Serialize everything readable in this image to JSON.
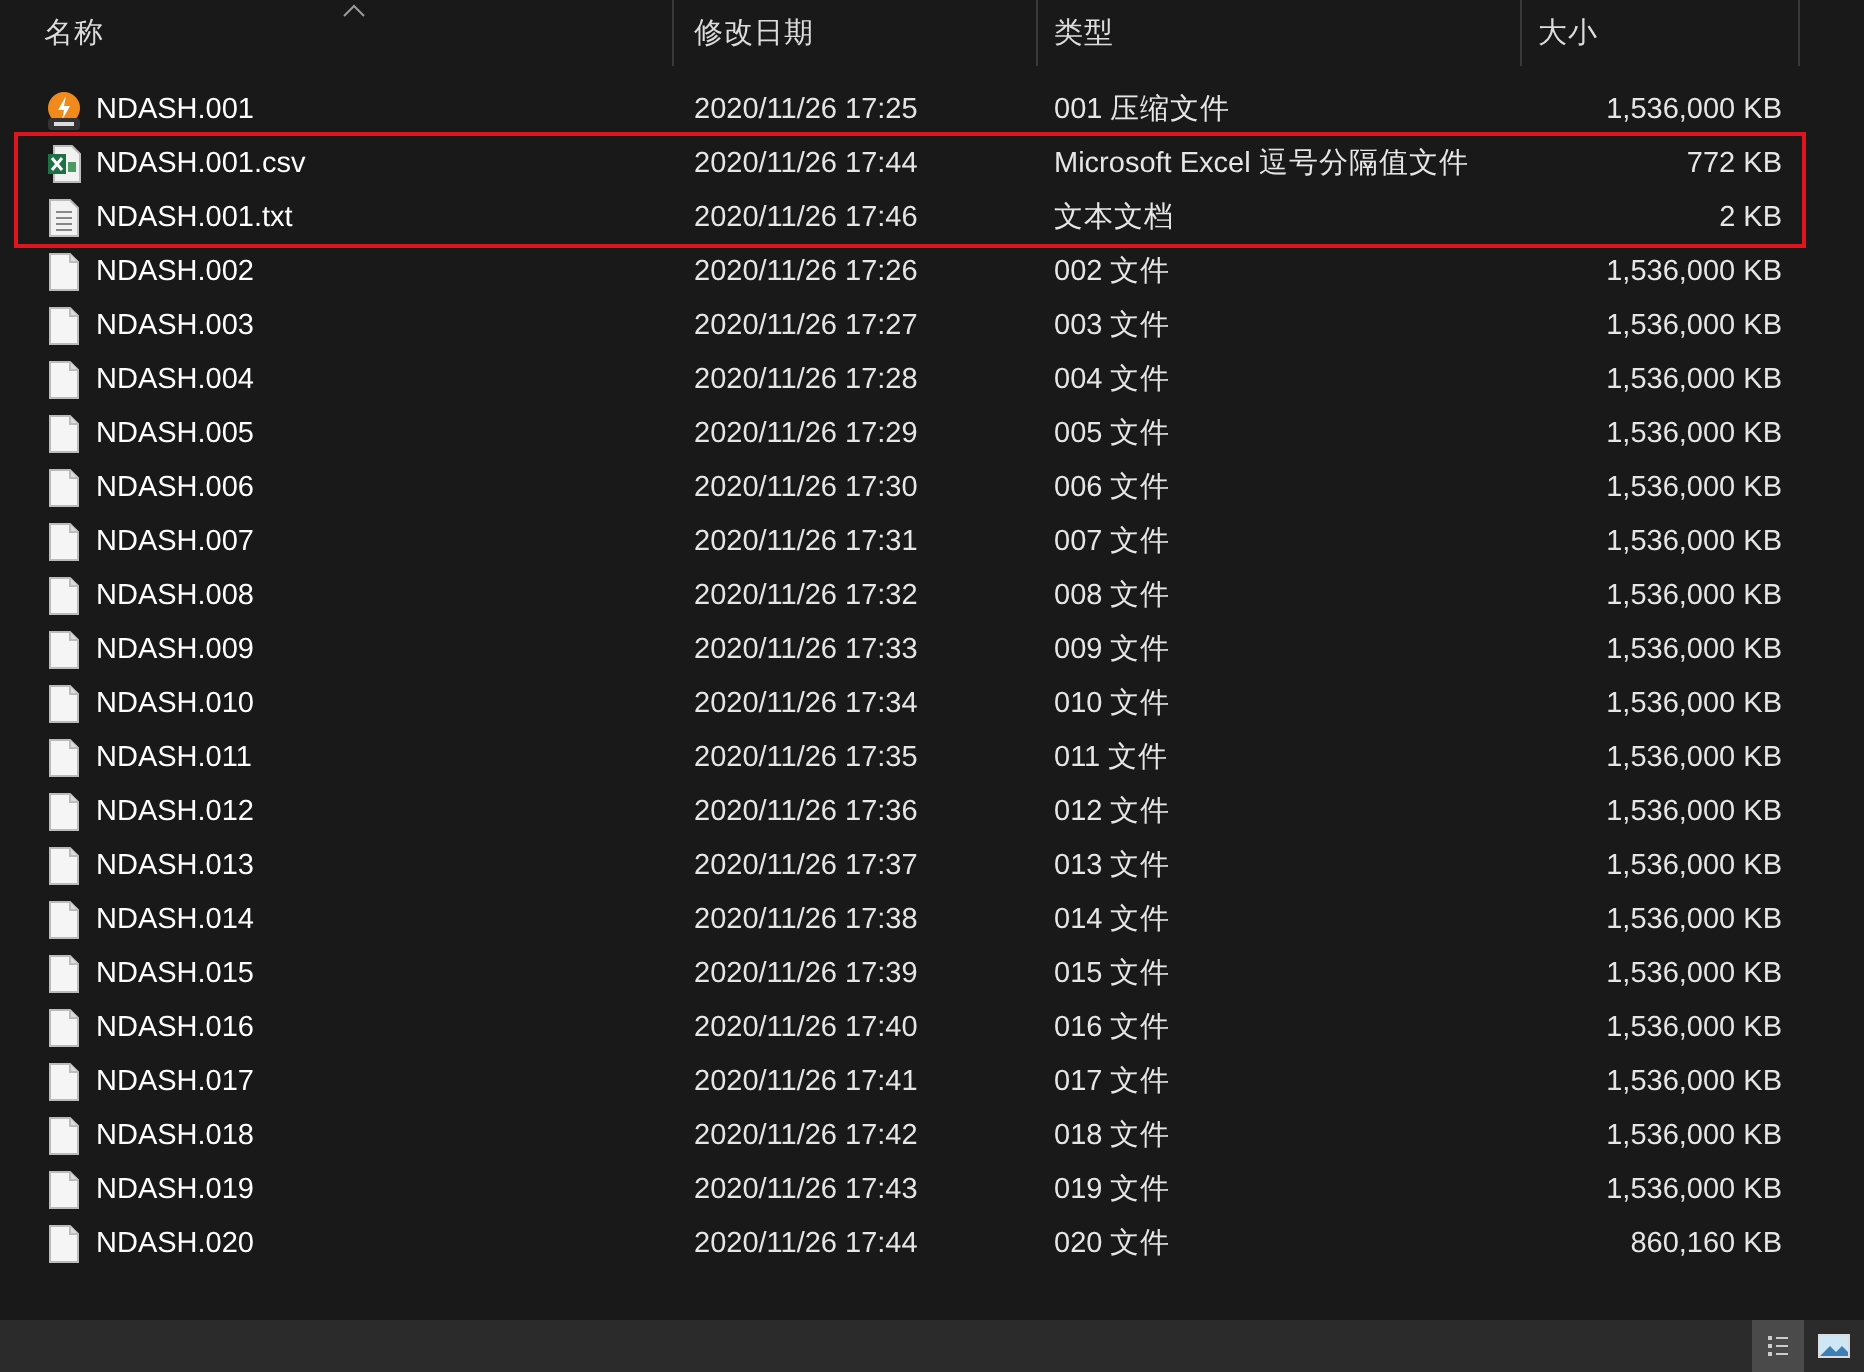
{
  "table": {
    "columns": [
      {
        "label": "名称",
        "sorted": true
      },
      {
        "label": "修改日期",
        "sorted": false
      },
      {
        "label": "类型",
        "sorted": false
      },
      {
        "label": "大小",
        "sorted": false
      }
    ],
    "rows": [
      {
        "kind": "archive",
        "highlighted": false,
        "name": "NDASH.001",
        "date": "2020/11/26 17:25",
        "type": "001 压缩文件",
        "size": "1,536,000 KB"
      },
      {
        "kind": "spreadsheet",
        "highlighted": true,
        "name": "NDASH.001.csv",
        "date": "2020/11/26 17:44",
        "type": "Microsoft Excel 逗号分隔值文件",
        "size": "772 KB"
      },
      {
        "kind": "text",
        "highlighted": true,
        "name": "NDASH.001.txt",
        "date": "2020/11/26 17:46",
        "type": "文本文档",
        "size": "2 KB"
      },
      {
        "kind": "file",
        "highlighted": false,
        "name": "NDASH.002",
        "date": "2020/11/26 17:26",
        "type": "002 文件",
        "size": "1,536,000 KB"
      },
      {
        "kind": "file",
        "highlighted": false,
        "name": "NDASH.003",
        "date": "2020/11/26 17:27",
        "type": "003 文件",
        "size": "1,536,000 KB"
      },
      {
        "kind": "file",
        "highlighted": false,
        "name": "NDASH.004",
        "date": "2020/11/26 17:28",
        "type": "004 文件",
        "size": "1,536,000 KB"
      },
      {
        "kind": "file",
        "highlighted": false,
        "name": "NDASH.005",
        "date": "2020/11/26 17:29",
        "type": "005 文件",
        "size": "1,536,000 KB"
      },
      {
        "kind": "file",
        "highlighted": false,
        "name": "NDASH.006",
        "date": "2020/11/26 17:30",
        "type": "006 文件",
        "size": "1,536,000 KB"
      },
      {
        "kind": "file",
        "highlighted": false,
        "name": "NDASH.007",
        "date": "2020/11/26 17:31",
        "type": "007 文件",
        "size": "1,536,000 KB"
      },
      {
        "kind": "file",
        "highlighted": false,
        "name": "NDASH.008",
        "date": "2020/11/26 17:32",
        "type": "008 文件",
        "size": "1,536,000 KB"
      },
      {
        "kind": "file",
        "highlighted": false,
        "name": "NDASH.009",
        "date": "2020/11/26 17:33",
        "type": "009 文件",
        "size": "1,536,000 KB"
      },
      {
        "kind": "file",
        "highlighted": false,
        "name": "NDASH.010",
        "date": "2020/11/26 17:34",
        "type": "010 文件",
        "size": "1,536,000 KB"
      },
      {
        "kind": "file",
        "highlighted": false,
        "name": "NDASH.011",
        "date": "2020/11/26 17:35",
        "type": "011 文件",
        "size": "1,536,000 KB"
      },
      {
        "kind": "file",
        "highlighted": false,
        "name": "NDASH.012",
        "date": "2020/11/26 17:36",
        "type": "012 文件",
        "size": "1,536,000 KB"
      },
      {
        "kind": "file",
        "highlighted": false,
        "name": "NDASH.013",
        "date": "2020/11/26 17:37",
        "type": "013 文件",
        "size": "1,536,000 KB"
      },
      {
        "kind": "file",
        "highlighted": false,
        "name": "NDASH.014",
        "date": "2020/11/26 17:38",
        "type": "014 文件",
        "size": "1,536,000 KB"
      },
      {
        "kind": "file",
        "highlighted": false,
        "name": "NDASH.015",
        "date": "2020/11/26 17:39",
        "type": "015 文件",
        "size": "1,536,000 KB"
      },
      {
        "kind": "file",
        "highlighted": false,
        "name": "NDASH.016",
        "date": "2020/11/26 17:40",
        "type": "016 文件",
        "size": "1,536,000 KB"
      },
      {
        "kind": "file",
        "highlighted": false,
        "name": "NDASH.017",
        "date": "2020/11/26 17:41",
        "type": "017 文件",
        "size": "1,536,000 KB"
      },
      {
        "kind": "file",
        "highlighted": false,
        "name": "NDASH.018",
        "date": "2020/11/26 17:42",
        "type": "018 文件",
        "size": "1,536,000 KB"
      },
      {
        "kind": "file",
        "highlighted": false,
        "name": "NDASH.019",
        "date": "2020/11/26 17:43",
        "type": "019 文件",
        "size": "1,536,000 KB"
      },
      {
        "kind": "file",
        "highlighted": false,
        "name": "NDASH.020",
        "date": "2020/11/26 17:44",
        "type": "020 文件",
        "size": "860,160 KB"
      }
    ]
  },
  "status_bar": {
    "view_buttons": [
      {
        "kind": "details",
        "selected": true
      },
      {
        "kind": "large_icons",
        "selected": false
      }
    ]
  }
}
